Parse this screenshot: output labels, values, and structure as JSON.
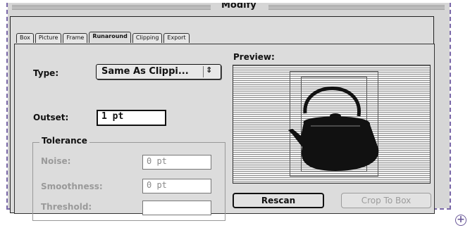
{
  "window": {
    "title": "Modify"
  },
  "tabs": [
    {
      "label": "Box",
      "active": false
    },
    {
      "label": "Picture",
      "active": false
    },
    {
      "label": "Frame",
      "active": false
    },
    {
      "label": "Runaround",
      "active": true
    },
    {
      "label": "Clipping",
      "active": false
    },
    {
      "label": "Export",
      "active": false
    }
  ],
  "runaround": {
    "type_label": "Type:",
    "type_value": "Same As Clippi...",
    "type_arrows": "⇕",
    "outset_label": "Outset:",
    "outset_value": "1 pt"
  },
  "tolerance": {
    "title": "Tolerance",
    "noise_label": "Noise:",
    "noise_value": "0 pt",
    "smoothness_label": "Smoothness:",
    "smoothness_value": "0 pt",
    "threshold_label": "Threshold:",
    "threshold_value": ""
  },
  "preview": {
    "label": "Preview:",
    "image_icon": "teapot-icon"
  },
  "buttons": {
    "rescan": "Rescan",
    "crop_to_box": "Crop To Box"
  },
  "colors": {
    "dialog_bg": "#d6d6d6",
    "crop_border": "#7a68a8",
    "disabled_text": "#9a9a9a"
  },
  "overlay": {
    "zoom_icon": "zoom-in-icon",
    "zoom_glyph": "+"
  }
}
